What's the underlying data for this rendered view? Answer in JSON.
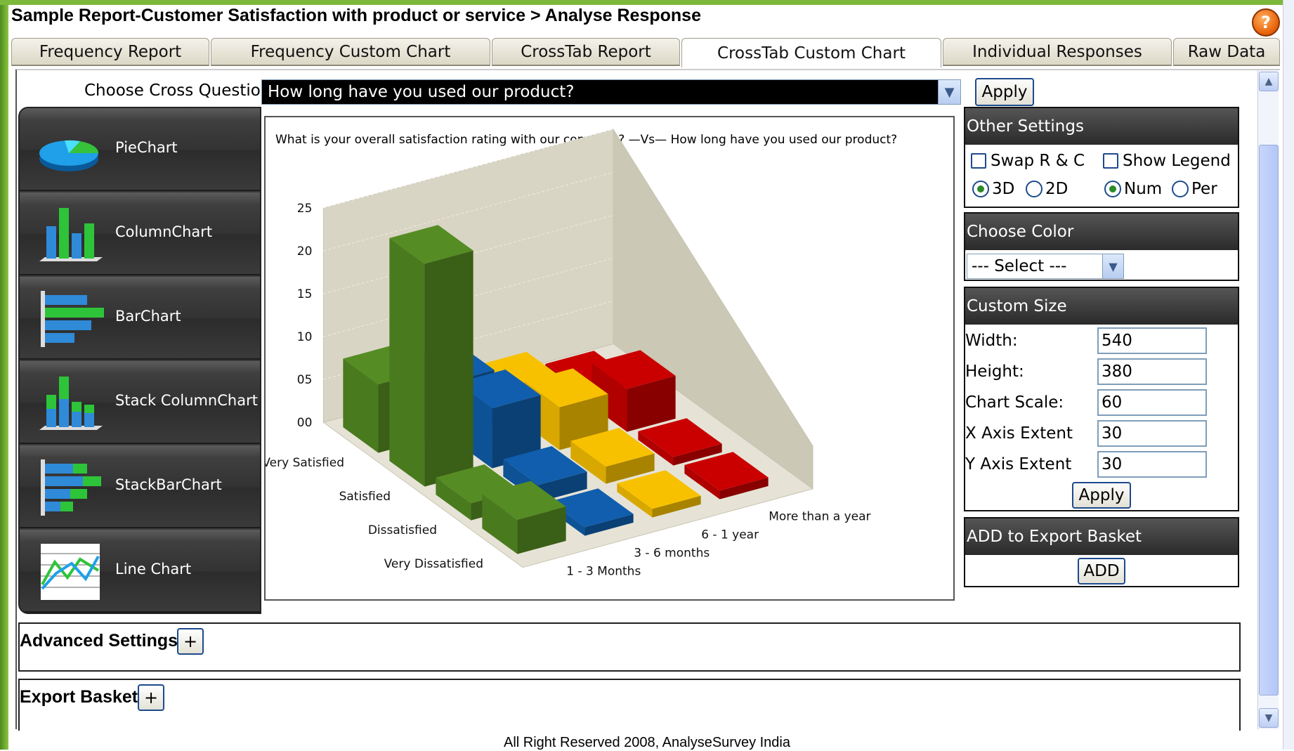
{
  "page_title": "Sample Report-Customer Satisfaction with product or service > Analyse Response",
  "help_icon_label": "?",
  "tabs": [
    {
      "label": "Frequency Report"
    },
    {
      "label": "Frequency Custom Chart"
    },
    {
      "label": "CrossTab Report"
    },
    {
      "label": "CrossTab Custom Chart"
    },
    {
      "label": "Individual Responses"
    },
    {
      "label": "Raw Data"
    }
  ],
  "cross_question": {
    "label": "Choose Cross Question",
    "selected": "How long have you used our product?",
    "apply_label": "Apply"
  },
  "chart_types": [
    {
      "label": "PieChart",
      "icon": "pie-chart-icon"
    },
    {
      "label": "ColumnChart",
      "icon": "column-chart-icon"
    },
    {
      "label": "BarChart",
      "icon": "bar-chart-icon"
    },
    {
      "label": "Stack ColumnChart",
      "icon": "stack-column-chart-icon"
    },
    {
      "label": "StackBarChart",
      "icon": "stack-bar-chart-icon"
    },
    {
      "label": "Line Chart",
      "icon": "line-chart-icon"
    }
  ],
  "chart_data": {
    "type": "bar",
    "title": "What is your overall satisfaction rating with our company? —Vs— How long have you used our product?",
    "categories": [
      "Very Satisfied",
      "Satisfied",
      "Dissatisfied",
      "Very Dissatisfied"
    ],
    "series": [
      {
        "name": "1 - 3 Months",
        "values": [
          8,
          26,
          2,
          4
        ],
        "color": "#4a7a1e"
      },
      {
        "name": "3 - 6 months",
        "values": [
          6,
          7,
          2,
          1
        ],
        "color": "#0e5296"
      },
      {
        "name": "6 - 1 year",
        "values": [
          3,
          5,
          2,
          1
        ],
        "color": "#d8a800"
      },
      {
        "name": "More than a year",
        "values": [
          1,
          5,
          1,
          1
        ],
        "color": "#b00000"
      }
    ],
    "y_ticks": [
      "00",
      "05",
      "10",
      "15",
      "20",
      "25"
    ],
    "ylim": [
      0,
      25
    ],
    "view": "3D"
  },
  "other_settings": {
    "header": "Other Settings",
    "swap_label": "Swap R & C",
    "swap_checked": false,
    "legend_label": "Show Legend",
    "legend_checked": false,
    "dim_3d_label": "3D",
    "dim_2d_label": "2D",
    "dim_selected": "3D",
    "num_label": "Num",
    "per_label": "Per",
    "mode_selected": "Num"
  },
  "choose_color": {
    "header": "Choose Color",
    "selected": "--- Select ---"
  },
  "custom_size": {
    "header": "Custom Size",
    "width_label": "Width:",
    "width_value": "540",
    "height_label": "Height:",
    "height_value": "380",
    "scale_label": "Chart Scale:",
    "scale_value": "60",
    "x_extent_label": "X Axis Extent",
    "x_extent_value": "30",
    "y_extent_label": "Y Axis Extent",
    "y_extent_value": "30",
    "apply_label": "Apply"
  },
  "export_basket_panel": {
    "header": "ADD to Export Basket",
    "add_label": "ADD"
  },
  "advanced_settings": {
    "title": "Advanced Settings",
    "toggle": "+"
  },
  "export_basket": {
    "title": "Export Basket",
    "toggle": "+"
  },
  "footer": "All Right Reserved 2008, AnalyseSurvey India"
}
